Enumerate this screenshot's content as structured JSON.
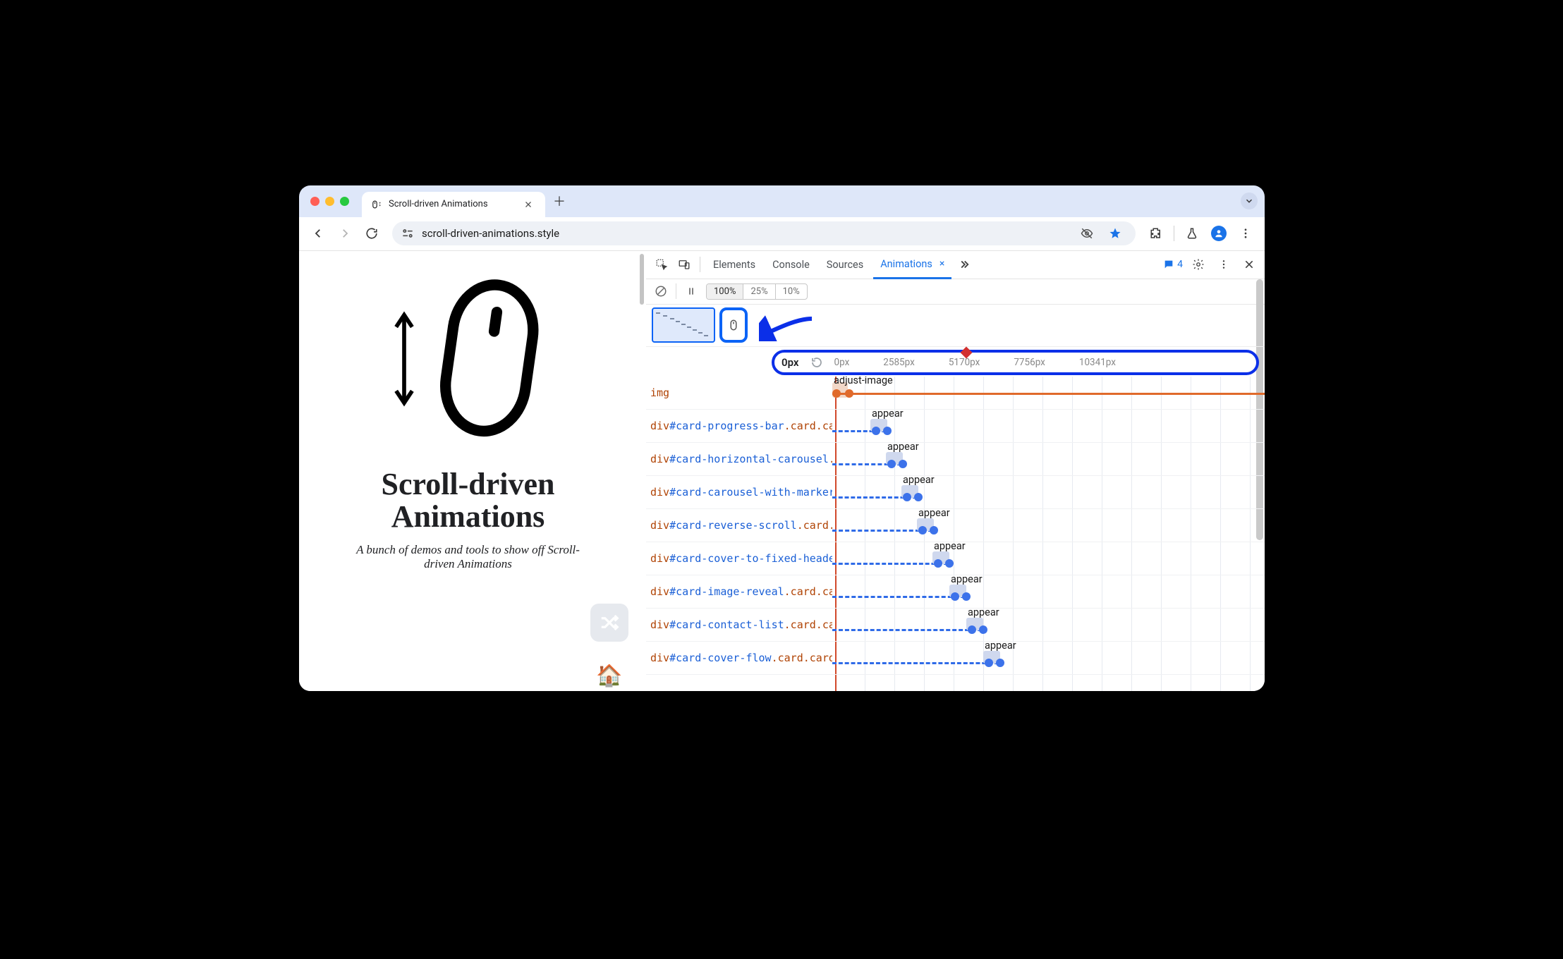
{
  "browser": {
    "tab_title": "Scroll-driven Animations",
    "url": "scroll-driven-animations.style"
  },
  "page": {
    "title": "Scroll-driven\nAnimations",
    "subtitle": "A bunch of demos and tools to show off Scroll-driven Animations"
  },
  "devtools": {
    "tabs": [
      "Elements",
      "Console",
      "Sources",
      "Animations"
    ],
    "message_count": "4",
    "speeds": [
      "100%",
      "25%",
      "10%"
    ],
    "timeline": {
      "current": "0px",
      "ticks": [
        "0px",
        "2585px",
        "5170px",
        "7756px",
        "10341px"
      ]
    },
    "rows": [
      {
        "tag": "img",
        "id": "",
        "cls": "",
        "anim": "adjust-image",
        "offset": 0,
        "kind": "img"
      },
      {
        "tag": "div",
        "id": "#card-progress-bar",
        "cls": ".card.ca",
        "anim": "appear",
        "offset": 58
      },
      {
        "tag": "div",
        "id": "#card-horizontal-carousel",
        "cls": ".",
        "anim": "appear",
        "offset": 80
      },
      {
        "tag": "div",
        "id": "#card-carousel-with-marker",
        "cls": "",
        "anim": "appear",
        "offset": 102
      },
      {
        "tag": "div",
        "id": "#card-reverse-scroll",
        "cls": ".card.",
        "anim": "appear",
        "offset": 124
      },
      {
        "tag": "div",
        "id": "#card-cover-to-fixed-heade",
        "cls": "",
        "anim": "appear",
        "offset": 146
      },
      {
        "tag": "div",
        "id": "#card-image-reveal",
        "cls": ".card.ca",
        "anim": "appear",
        "offset": 170
      },
      {
        "tag": "div",
        "id": "#card-contact-list",
        "cls": ".card.ca",
        "anim": "appear",
        "offset": 194
      },
      {
        "tag": "div",
        "id": "#card-cover-flow",
        "cls": ".card.card",
        "anim": "appear",
        "offset": 218
      }
    ]
  }
}
